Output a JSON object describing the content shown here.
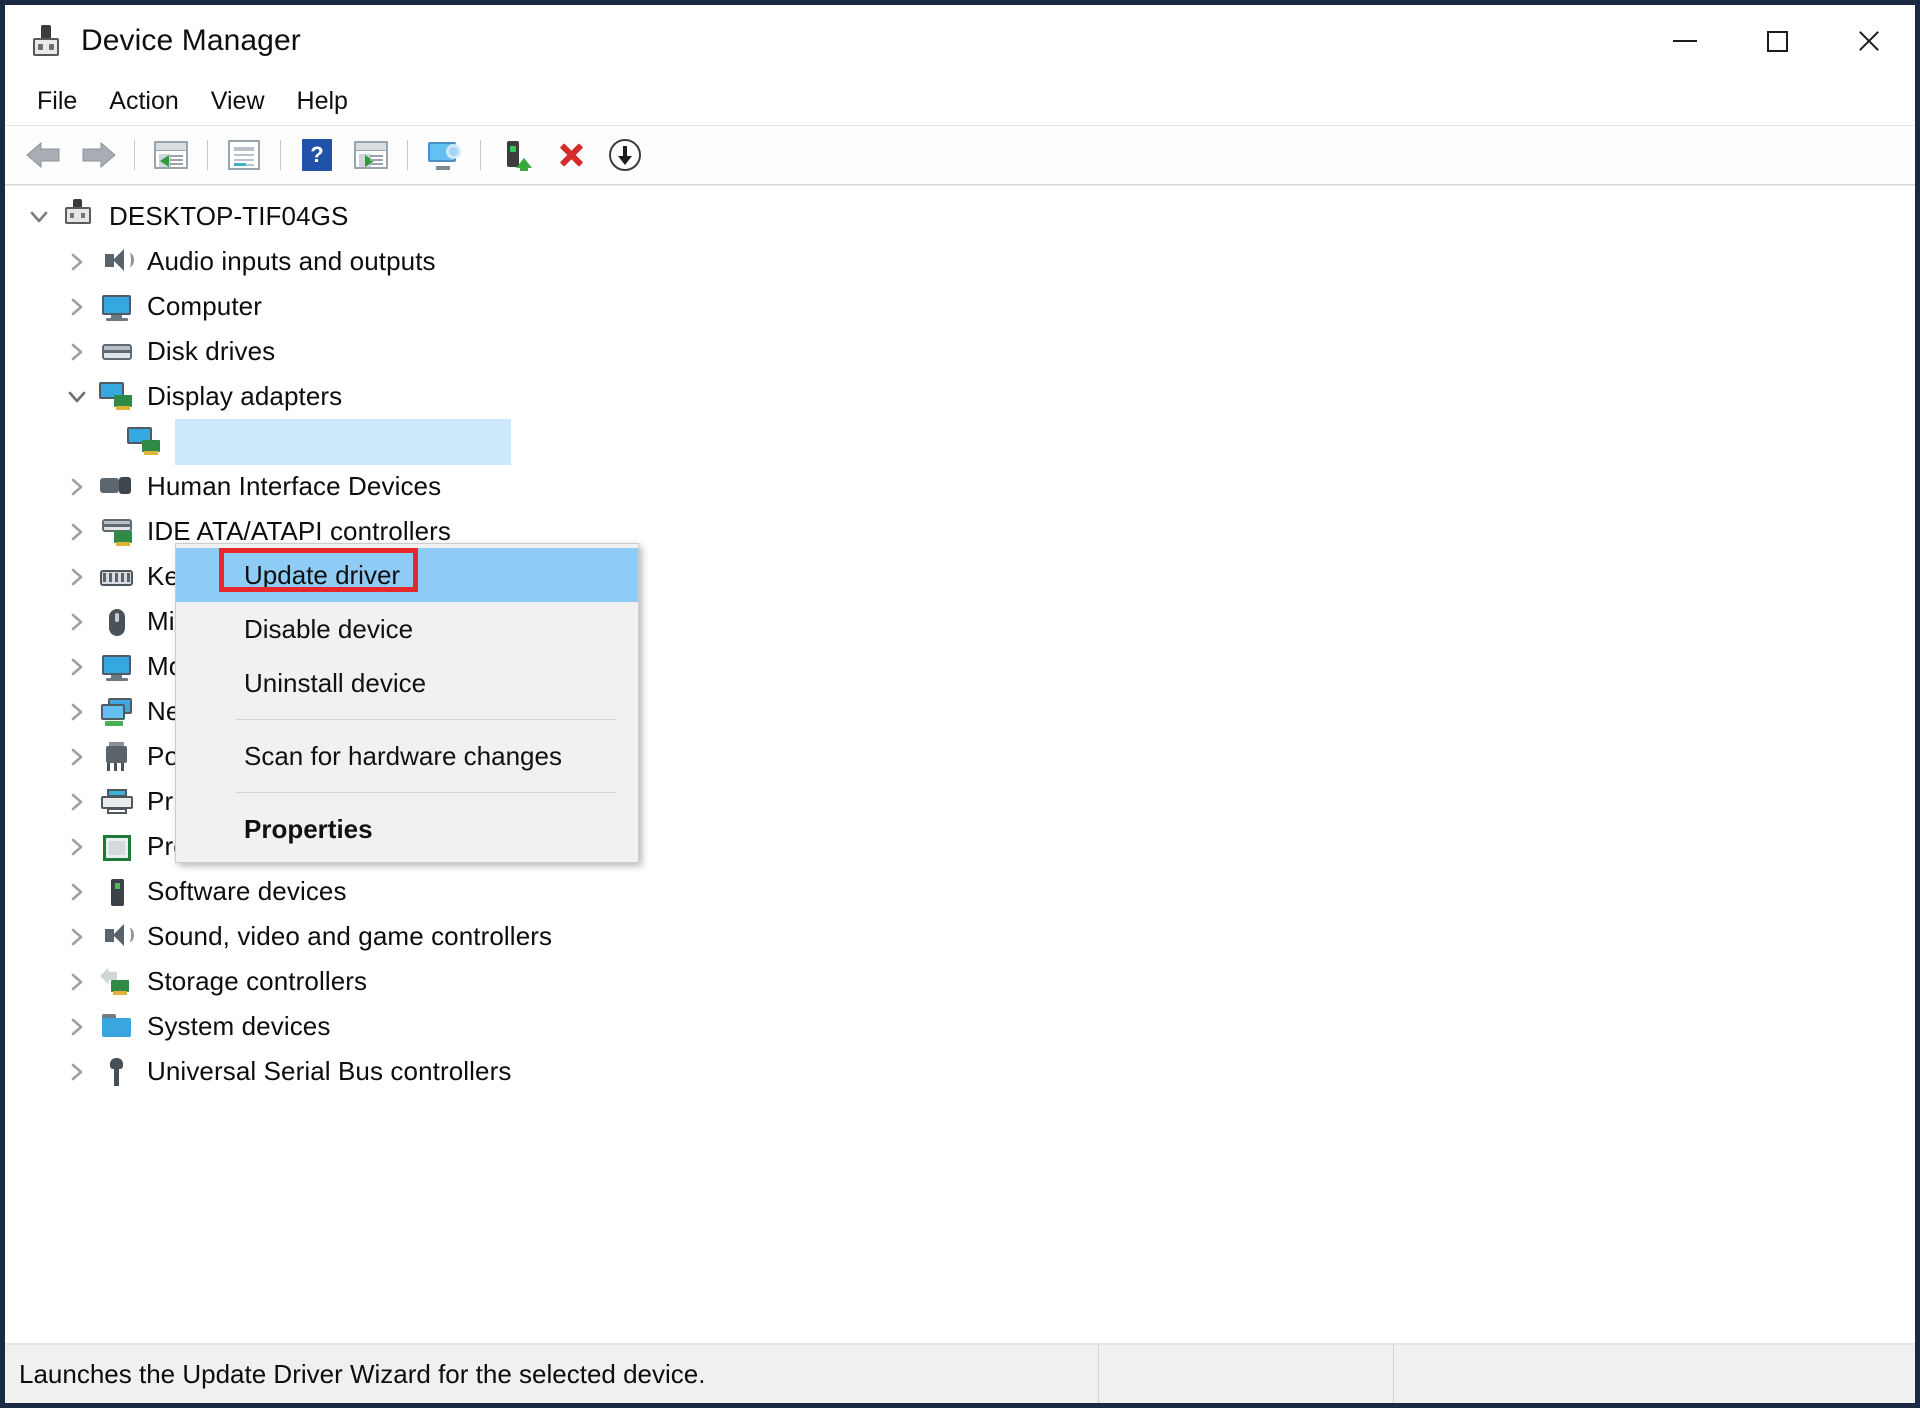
{
  "window": {
    "title": "Device Manager",
    "icon": "device-manager-icon",
    "controls": {
      "minimize": "minimize-icon",
      "maximize": "maximize-icon",
      "close": "close-icon"
    }
  },
  "menubar": {
    "items": [
      {
        "label": "File"
      },
      {
        "label": "Action"
      },
      {
        "label": "View"
      },
      {
        "label": "Help"
      }
    ]
  },
  "toolbar": {
    "buttons": [
      {
        "name": "back-icon",
        "type": "arrow-back"
      },
      {
        "name": "forward-icon",
        "type": "arrow-forward"
      },
      {
        "name": "separator-1",
        "type": "separator"
      },
      {
        "name": "show-hide-console-tree-icon",
        "type": "window-left"
      },
      {
        "name": "separator-2",
        "type": "separator"
      },
      {
        "name": "properties-icon",
        "type": "properties"
      },
      {
        "name": "separator-3",
        "type": "separator"
      },
      {
        "name": "help-icon",
        "type": "help",
        "glyph": "?"
      },
      {
        "name": "show-hide-action-pane-icon",
        "type": "window-right"
      },
      {
        "name": "separator-4",
        "type": "separator"
      },
      {
        "name": "scan-for-hardware-changes-icon",
        "type": "scan"
      },
      {
        "name": "separator-5",
        "type": "separator"
      },
      {
        "name": "update-driver-icon",
        "type": "update-driver"
      },
      {
        "name": "uninstall-device-icon",
        "type": "red-x"
      },
      {
        "name": "disable-device-icon",
        "type": "down-arrow-circle"
      }
    ]
  },
  "tree": {
    "root": {
      "label": "DESKTOP-TIF04GS",
      "icon": "computer-device-icon",
      "expanded": true
    },
    "items": [
      {
        "label": "Audio inputs and outputs",
        "icon": "speaker-icon",
        "expanded": false,
        "indent": 1
      },
      {
        "label": "Computer",
        "icon": "monitor-icon",
        "expanded": false,
        "indent": 1
      },
      {
        "label": "Disk drives",
        "icon": "disk-drive-icon",
        "expanded": false,
        "indent": 1
      },
      {
        "label": "Display adapters",
        "icon": "display-adapter-icon",
        "expanded": true,
        "indent": 1
      },
      {
        "label": "",
        "icon": "display-adapter-icon",
        "expanded": null,
        "indent": 2,
        "selected": true
      },
      {
        "label": "Human Interface Devices",
        "icon": "hid-icon",
        "expanded": false,
        "indent": 1,
        "truncated": "Hu"
      },
      {
        "label": "IDE ATA/ATAPI controllers",
        "icon": "ide-controller-icon",
        "expanded": false,
        "indent": 1,
        "truncated": "IDE"
      },
      {
        "label": "Keyboards",
        "icon": "keyboard-icon",
        "expanded": false,
        "indent": 1,
        "truncated": "Key"
      },
      {
        "label": "Mice and other pointing devices",
        "icon": "mouse-icon",
        "expanded": false,
        "indent": 1,
        "truncated": "Mic"
      },
      {
        "label": "Monitors",
        "icon": "monitor-icon",
        "expanded": false,
        "indent": 1,
        "truncated": "Mo"
      },
      {
        "label": "Network adapters",
        "icon": "network-adapter-icon",
        "expanded": false,
        "indent": 1,
        "truncated": "Net"
      },
      {
        "label": "Ports (COM & LPT)",
        "icon": "port-icon",
        "expanded": false,
        "indent": 1
      },
      {
        "label": "Print queues",
        "icon": "printer-icon",
        "expanded": false,
        "indent": 1
      },
      {
        "label": "Processors",
        "icon": "processor-icon",
        "expanded": false,
        "indent": 1
      },
      {
        "label": "Software devices",
        "icon": "software-device-icon",
        "expanded": false,
        "indent": 1
      },
      {
        "label": "Sound, video and game controllers",
        "icon": "speaker-icon",
        "expanded": false,
        "indent": 1
      },
      {
        "label": "Storage controllers",
        "icon": "storage-controller-icon",
        "expanded": false,
        "indent": 1
      },
      {
        "label": "System devices",
        "icon": "system-device-icon",
        "expanded": false,
        "indent": 1
      },
      {
        "label": "Universal Serial Bus controllers",
        "icon": "usb-icon",
        "expanded": false,
        "indent": 1
      }
    ]
  },
  "context_menu": {
    "items": [
      {
        "label": "Update driver",
        "highlighted": true,
        "bold": false
      },
      {
        "label": "Disable device",
        "highlighted": false,
        "bold": false
      },
      {
        "label": "Uninstall device",
        "highlighted": false,
        "bold": false
      },
      {
        "separator": true
      },
      {
        "label": "Scan for hardware changes",
        "highlighted": false,
        "bold": false
      },
      {
        "separator": true
      },
      {
        "label": "Properties",
        "highlighted": false,
        "bold": true
      }
    ]
  },
  "annotation": {
    "highlight_color": "#e8272c",
    "highlight_target": "Update driver"
  },
  "statusbar": {
    "message": "Launches the Update Driver Wizard for the selected device.",
    "pane2": "",
    "pane3": ""
  },
  "colors": {
    "selection": "#cde8fa",
    "menu_highlight": "#8ecbf5",
    "window_border": "#1b2a44",
    "annotation_red": "#e8272c"
  }
}
